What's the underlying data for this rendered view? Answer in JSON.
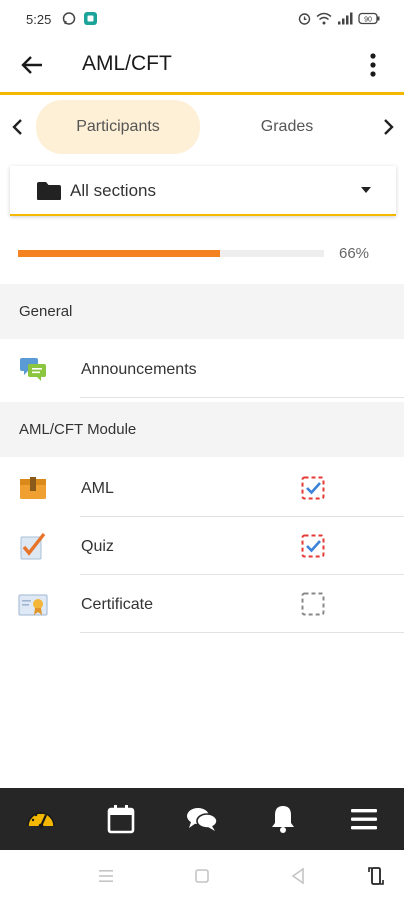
{
  "status_bar": {
    "time": "5:25",
    "battery": "90"
  },
  "app_bar": {
    "title": "AML/CFT"
  },
  "tabs": [
    {
      "label": "Participants",
      "active": true
    },
    {
      "label": "Grades",
      "active": false
    }
  ],
  "section_select": {
    "value": "All sections"
  },
  "progress": {
    "percent": 66,
    "text": "66%"
  },
  "sections": [
    {
      "title": "General",
      "items": [
        {
          "label": "Announcements",
          "icon": "forum-icon",
          "completion": null
        }
      ]
    },
    {
      "title": "AML/CFT Module",
      "items": [
        {
          "label": "AML",
          "icon": "package-icon",
          "completion": "done"
        },
        {
          "label": "Quiz",
          "icon": "quiz-icon",
          "completion": "done"
        },
        {
          "label": "Certificate",
          "icon": "certificate-icon",
          "completion": "pending"
        }
      ]
    }
  ],
  "bottom_nav": [
    {
      "icon": "dashboard-icon",
      "active": true
    },
    {
      "icon": "calendar-icon",
      "active": false
    },
    {
      "icon": "messages-icon",
      "active": false
    },
    {
      "icon": "notifications-icon",
      "active": false
    },
    {
      "icon": "menu-icon",
      "active": false
    }
  ],
  "colors": {
    "accent": "#f5b800",
    "progress": "#f58220",
    "tab_active_bg": "#fdf0d6",
    "nav_bg": "#262626",
    "check_done": "#3b82d8",
    "check_border_done": "#e53935",
    "check_border_pending": "#888888"
  }
}
